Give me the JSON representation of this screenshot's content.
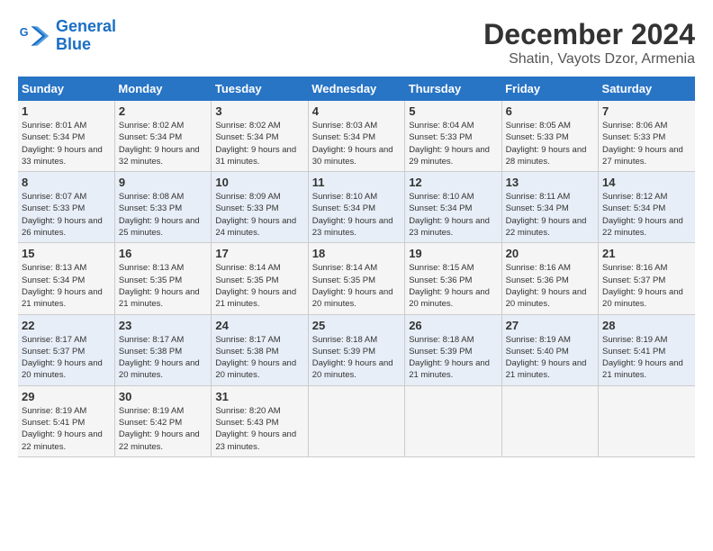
{
  "logo": {
    "text_general": "General",
    "text_blue": "Blue"
  },
  "header": {
    "month": "December 2024",
    "location": "Shatin, Vayots Dzor, Armenia"
  },
  "days_of_week": [
    "Sunday",
    "Monday",
    "Tuesday",
    "Wednesday",
    "Thursday",
    "Friday",
    "Saturday"
  ],
  "weeks": [
    [
      {
        "day": "1",
        "sunrise": "8:01 AM",
        "sunset": "5:34 PM",
        "daylight": "9 hours and 33 minutes."
      },
      {
        "day": "2",
        "sunrise": "8:02 AM",
        "sunset": "5:34 PM",
        "daylight": "9 hours and 32 minutes."
      },
      {
        "day": "3",
        "sunrise": "8:02 AM",
        "sunset": "5:34 PM",
        "daylight": "9 hours and 31 minutes."
      },
      {
        "day": "4",
        "sunrise": "8:03 AM",
        "sunset": "5:34 PM",
        "daylight": "9 hours and 30 minutes."
      },
      {
        "day": "5",
        "sunrise": "8:04 AM",
        "sunset": "5:33 PM",
        "daylight": "9 hours and 29 minutes."
      },
      {
        "day": "6",
        "sunrise": "8:05 AM",
        "sunset": "5:33 PM",
        "daylight": "9 hours and 28 minutes."
      },
      {
        "day": "7",
        "sunrise": "8:06 AM",
        "sunset": "5:33 PM",
        "daylight": "9 hours and 27 minutes."
      }
    ],
    [
      {
        "day": "8",
        "sunrise": "8:07 AM",
        "sunset": "5:33 PM",
        "daylight": "9 hours and 26 minutes."
      },
      {
        "day": "9",
        "sunrise": "8:08 AM",
        "sunset": "5:33 PM",
        "daylight": "9 hours and 25 minutes."
      },
      {
        "day": "10",
        "sunrise": "8:09 AM",
        "sunset": "5:33 PM",
        "daylight": "9 hours and 24 minutes."
      },
      {
        "day": "11",
        "sunrise": "8:10 AM",
        "sunset": "5:34 PM",
        "daylight": "9 hours and 23 minutes."
      },
      {
        "day": "12",
        "sunrise": "8:10 AM",
        "sunset": "5:34 PM",
        "daylight": "9 hours and 23 minutes."
      },
      {
        "day": "13",
        "sunrise": "8:11 AM",
        "sunset": "5:34 PM",
        "daylight": "9 hours and 22 minutes."
      },
      {
        "day": "14",
        "sunrise": "8:12 AM",
        "sunset": "5:34 PM",
        "daylight": "9 hours and 22 minutes."
      }
    ],
    [
      {
        "day": "15",
        "sunrise": "8:13 AM",
        "sunset": "5:34 PM",
        "daylight": "9 hours and 21 minutes."
      },
      {
        "day": "16",
        "sunrise": "8:13 AM",
        "sunset": "5:35 PM",
        "daylight": "9 hours and 21 minutes."
      },
      {
        "day": "17",
        "sunrise": "8:14 AM",
        "sunset": "5:35 PM",
        "daylight": "9 hours and 21 minutes."
      },
      {
        "day": "18",
        "sunrise": "8:14 AM",
        "sunset": "5:35 PM",
        "daylight": "9 hours and 20 minutes."
      },
      {
        "day": "19",
        "sunrise": "8:15 AM",
        "sunset": "5:36 PM",
        "daylight": "9 hours and 20 minutes."
      },
      {
        "day": "20",
        "sunrise": "8:16 AM",
        "sunset": "5:36 PM",
        "daylight": "9 hours and 20 minutes."
      },
      {
        "day": "21",
        "sunrise": "8:16 AM",
        "sunset": "5:37 PM",
        "daylight": "9 hours and 20 minutes."
      }
    ],
    [
      {
        "day": "22",
        "sunrise": "8:17 AM",
        "sunset": "5:37 PM",
        "daylight": "9 hours and 20 minutes."
      },
      {
        "day": "23",
        "sunrise": "8:17 AM",
        "sunset": "5:38 PM",
        "daylight": "9 hours and 20 minutes."
      },
      {
        "day": "24",
        "sunrise": "8:17 AM",
        "sunset": "5:38 PM",
        "daylight": "9 hours and 20 minutes."
      },
      {
        "day": "25",
        "sunrise": "8:18 AM",
        "sunset": "5:39 PM",
        "daylight": "9 hours and 20 minutes."
      },
      {
        "day": "26",
        "sunrise": "8:18 AM",
        "sunset": "5:39 PM",
        "daylight": "9 hours and 21 minutes."
      },
      {
        "day": "27",
        "sunrise": "8:19 AM",
        "sunset": "5:40 PM",
        "daylight": "9 hours and 21 minutes."
      },
      {
        "day": "28",
        "sunrise": "8:19 AM",
        "sunset": "5:41 PM",
        "daylight": "9 hours and 21 minutes."
      }
    ],
    [
      {
        "day": "29",
        "sunrise": "8:19 AM",
        "sunset": "5:41 PM",
        "daylight": "9 hours and 22 minutes."
      },
      {
        "day": "30",
        "sunrise": "8:19 AM",
        "sunset": "5:42 PM",
        "daylight": "9 hours and 22 minutes."
      },
      {
        "day": "31",
        "sunrise": "8:20 AM",
        "sunset": "5:43 PM",
        "daylight": "9 hours and 23 minutes."
      },
      null,
      null,
      null,
      null
    ]
  ]
}
